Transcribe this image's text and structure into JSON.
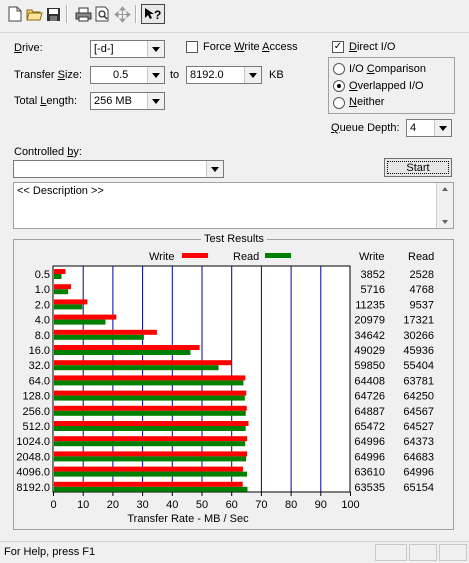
{
  "toolbar": {
    "buttons": [
      "new-icon",
      "open-icon",
      "save-icon",
      "print-icon",
      "print-preview-icon",
      "move-icon",
      "context-help-icon"
    ]
  },
  "drive": {
    "label": "Drive:",
    "value": "[-d-]"
  },
  "force_write_access": {
    "label": "Force Write Access",
    "checked": false
  },
  "direct_io": {
    "label": "Direct I/O",
    "checked": true
  },
  "transfer_size": {
    "label": "Transfer Size:",
    "from": "0.5",
    "to_label": "to",
    "to": "8192.0",
    "unit": "KB"
  },
  "total_length": {
    "label": "Total Length:",
    "value": "256 MB"
  },
  "io_mode": {
    "options": [
      "I/O Comparison",
      "Overlapped I/O",
      "Neither"
    ],
    "selected": "Overlapped I/O"
  },
  "queue_depth": {
    "label": "Queue Depth:",
    "value": "4"
  },
  "controlled_by": {
    "label": "Controlled by:",
    "value": ""
  },
  "start_button": {
    "label": "Start"
  },
  "description": {
    "text": "<< Description >>"
  },
  "test_results": {
    "title": "Test Results",
    "write_column": "Write",
    "read_column": "Read"
  },
  "chart_data": {
    "type": "bar",
    "orientation": "horizontal",
    "categories": [
      "0.5",
      "1.0",
      "2.0",
      "4.0",
      "8.0",
      "16.0",
      "32.0",
      "64.0",
      "128.0",
      "256.0",
      "512.0",
      "1024.0",
      "2048.0",
      "4096.0",
      "8192.0"
    ],
    "series": [
      {
        "name": "Write",
        "color": "#ff0000",
        "values": [
          3852,
          5716,
          11235,
          20979,
          34642,
          49029,
          59850,
          64408,
          64726,
          64887,
          65472,
          64996,
          64996,
          63610,
          63535
        ]
      },
      {
        "name": "Read",
        "color": "#008000",
        "values": [
          2528,
          4768,
          9537,
          17321,
          30266,
          45936,
          55404,
          63781,
          64250,
          64567,
          64527,
          64373,
          64683,
          64996,
          65154
        ]
      }
    ],
    "xlabel": "Transfer Rate - MB / Sec",
    "xlim": [
      0,
      100
    ],
    "xticks": [
      "0",
      "10",
      "20",
      "30",
      "40",
      "50",
      "60",
      "70",
      "80",
      "90",
      "100"
    ],
    "value_unit_divisor": 1000,
    "grid": true,
    "legend": "top"
  },
  "status_bar": {
    "text": "For Help, press F1"
  }
}
